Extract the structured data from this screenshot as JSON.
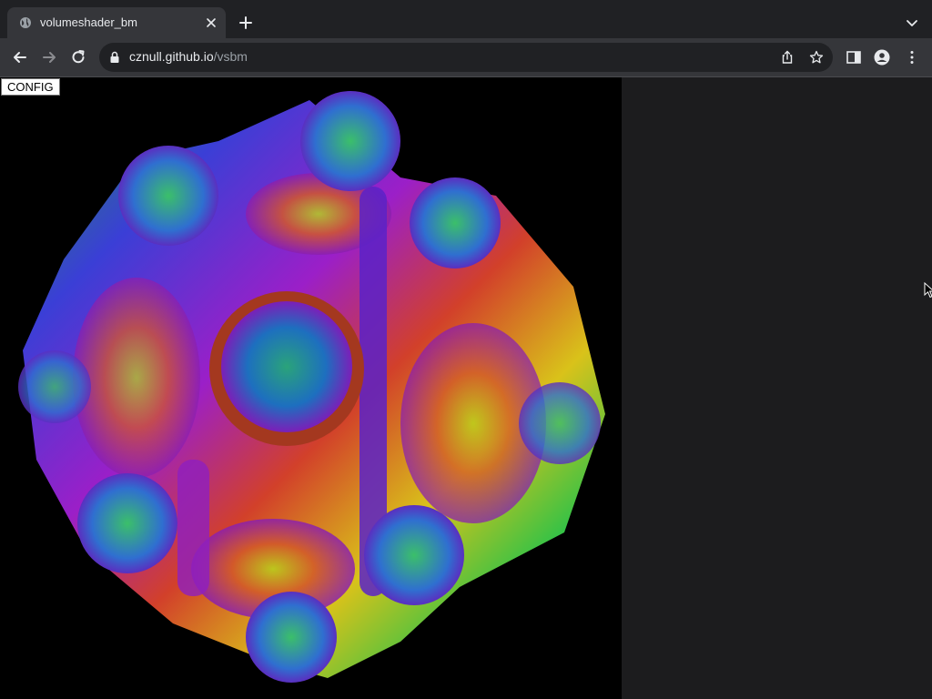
{
  "browser": {
    "tab_title": "volumeshader_bm",
    "url_host": "cznull.github.io",
    "url_path": "/vsbm"
  },
  "page": {
    "config_label": "CONFIG",
    "canvas_description": "fractal volume render"
  },
  "colors": {
    "tab_bg": "#35363a",
    "frame_bg": "#202124",
    "canvas_bg": "#000000",
    "right_panel_bg": "#1c1c1e"
  }
}
